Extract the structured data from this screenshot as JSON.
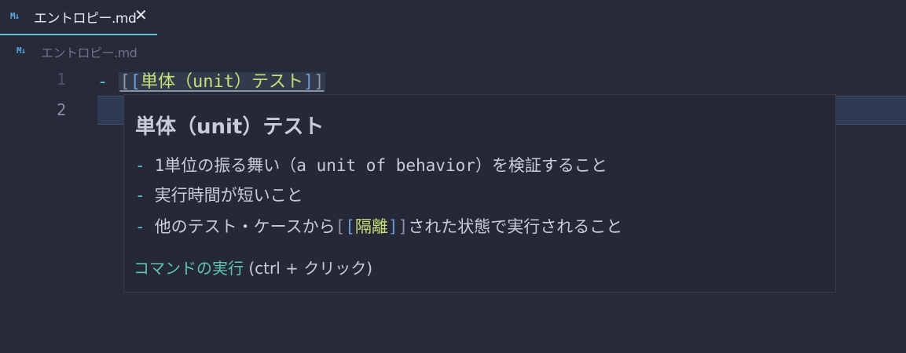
{
  "tab": {
    "icon": "markdown-icon",
    "icon_text": "M↓",
    "label": "エントロピー.md",
    "close_glyph": "✕"
  },
  "breadcrumb": {
    "icon": "markdown-icon",
    "icon_text": "M↓",
    "label": "エントロピー.md"
  },
  "editor": {
    "lines": [
      {
        "number": "1",
        "dash": "-",
        "open_outer": "[",
        "open_inner": "[",
        "link_text": "単体（unit）テスト",
        "close_inner": "]",
        "close_outer": "]"
      },
      {
        "number": "2"
      }
    ]
  },
  "hover": {
    "title": "単体（unit）テスト",
    "items": [
      {
        "dash": "-",
        "text": "1単位の振る舞い（a unit of behavior）を検証すること"
      },
      {
        "dash": "-",
        "text": "実行時間が短いこと"
      },
      {
        "dash": "-",
        "text_before": "他のテスト・ケースから",
        "open_outer": "[",
        "open_inner": "[",
        "link_text": "隔離",
        "close_inner": "]",
        "close_outer": "]",
        "text_after": "された状態で実行されること"
      }
    ],
    "footer_link": "コマンドの実行",
    "footer_hint": " (ctrl + クリック)"
  },
  "colors": {
    "background": "#272a39",
    "accent": "#5fc3d3",
    "link": "#c6e07a",
    "bracket": "#6c9bd4",
    "footer_link": "#5fc3b3"
  }
}
